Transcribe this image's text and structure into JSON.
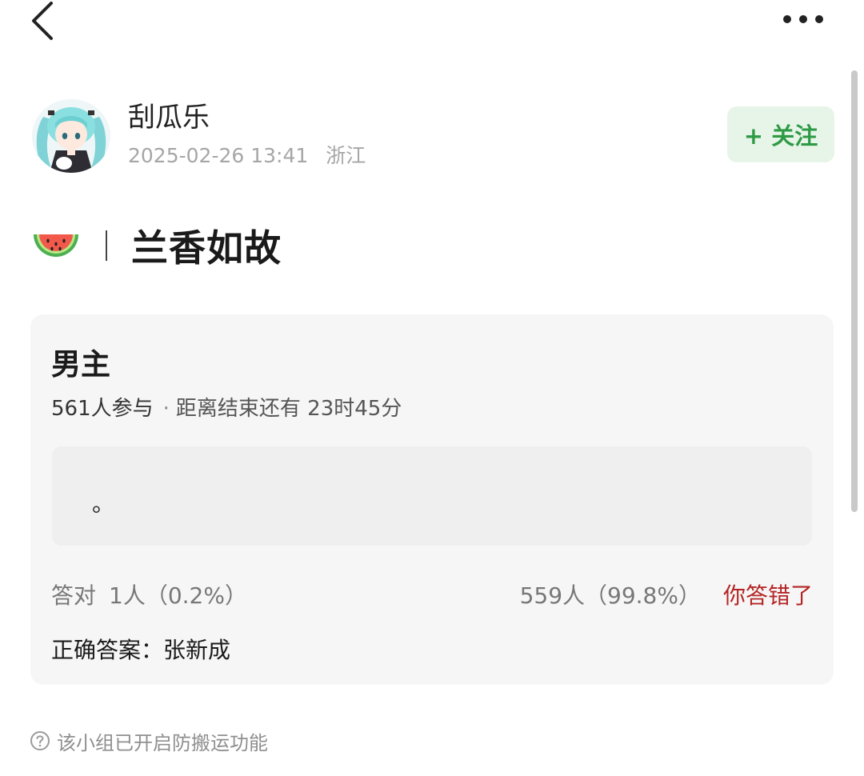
{
  "topbar": {
    "back_icon": "chevron-left-icon",
    "more_icon": "more-dots-icon"
  },
  "author": {
    "name": "刮瓜乐",
    "datetime": "2025-02-26 13:41",
    "location": "浙江",
    "follow_label": "+ 关注"
  },
  "post": {
    "title": "兰香如故",
    "title_icon": "watermelon-icon"
  },
  "quiz": {
    "question": "男主",
    "participants": "561人参与",
    "separator": "·",
    "remaining": "距离结束还有 23时45分",
    "answer_text": "。",
    "correct_label": "答对",
    "correct_count": "1人（0.2%）",
    "wrong_count": "559人（99.8%）",
    "wrong_label": "你答错了",
    "correct_answer": "正确答案：张新成"
  },
  "footer": {
    "notice": "该小组已开启防搬运功能",
    "notice_icon": "question-circle-icon"
  },
  "colors": {
    "follow_bg": "#e7f5e9",
    "follow_text": "#2e9a45",
    "wrong_text": "#b42424",
    "card_bg": "#f6f6f6"
  }
}
